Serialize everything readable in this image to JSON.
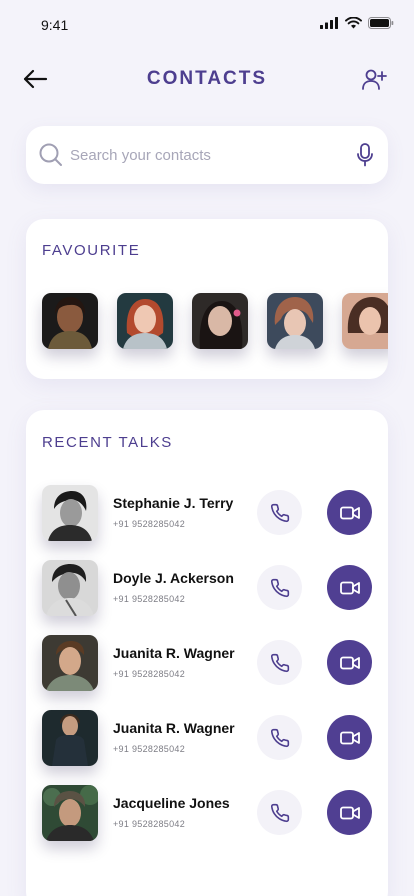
{
  "status_bar": {
    "time": "9:41"
  },
  "header": {
    "title": "CONTACTS",
    "back_icon": "arrow-left-icon",
    "add_icon": "add-user-icon"
  },
  "search": {
    "placeholder": "Search your contacts",
    "value": "",
    "icon": "search-icon",
    "mic_icon": "microphone-icon"
  },
  "favourite": {
    "title": "FAVOURITE",
    "avatars": [
      "favourite-avatar-1",
      "favourite-avatar-2",
      "favourite-avatar-3",
      "favourite-avatar-4",
      "favourite-avatar-5"
    ]
  },
  "recent": {
    "title": "RECENT TALKS",
    "contacts": [
      {
        "name": "Stephanie J. Terry",
        "phone": "+91 9528285042"
      },
      {
        "name": "Doyle J. Ackerson",
        "phone": "+91 9528285042"
      },
      {
        "name": "Juanita R. Wagner",
        "phone": "+91 9528285042"
      },
      {
        "name": "Juanita R. Wagner",
        "phone": "+91 9528285042"
      },
      {
        "name": "Jacqueline Jones",
        "phone": "+91 9528285042"
      }
    ]
  },
  "colors": {
    "accent": "#4d3e8f",
    "video_button": "#503f92",
    "call_button_bg": "#f3f2f8",
    "background": "#f4f3fa"
  }
}
